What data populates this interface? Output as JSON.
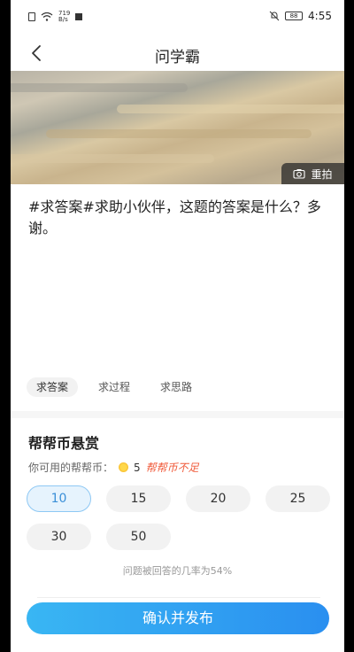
{
  "status_bar": {
    "speed_top": "719",
    "speed_unit": "B/s",
    "battery": "88",
    "time": "4:55"
  },
  "nav": {
    "title": "问学霸"
  },
  "photo": {
    "retake_label": "重拍"
  },
  "question": {
    "text": "#求答案#求助小伙伴，这题的答案是什么？多谢。"
  },
  "tags": [
    {
      "label": "求答案",
      "active": true
    },
    {
      "label": "求过程",
      "active": false
    },
    {
      "label": "求思路",
      "active": false
    }
  ],
  "reward": {
    "title": "帮帮币悬赏",
    "available_label": "你可用的帮帮币：",
    "coin_count": "5",
    "insufficient": "帮帮币不足",
    "options": [
      "10",
      "15",
      "20",
      "25",
      "30",
      "50"
    ],
    "selected": "10",
    "probability_text": "问题被回答的几率为54%"
  },
  "confirm_button": "确认并发布"
}
